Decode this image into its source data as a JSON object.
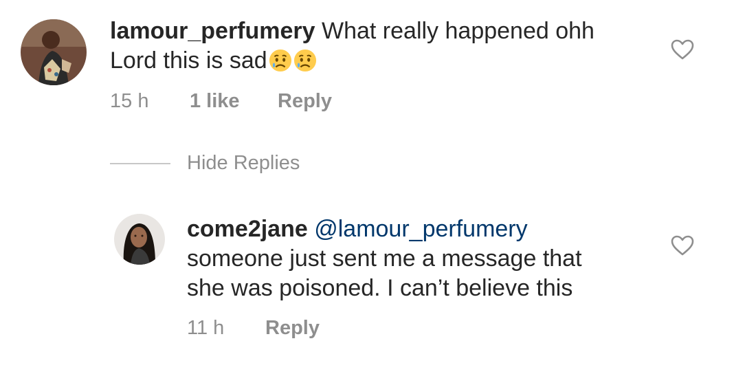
{
  "comments": [
    {
      "username": "lamour_perfumery",
      "text_line1": "What really happened ohh",
      "text_line2": "Lord this is sad",
      "emoji_icons": [
        "sad-relieved-face-icon",
        "sad-relieved-face-icon"
      ],
      "time": "15 h",
      "likes": "1 like",
      "reply_label": "Reply"
    }
  ],
  "replies_toggle": {
    "label": "Hide Replies"
  },
  "replies": [
    {
      "username": "come2jane",
      "mention": "@lamour_perfumery",
      "text_line1": "someone just sent me a message that",
      "text_line2": "she was poisoned. I can’t believe this",
      "time": "11 h",
      "reply_label": "Reply"
    }
  ],
  "colors": {
    "text": "#262626",
    "secondary": "#8e8e8e",
    "mention": "#00376b",
    "divider": "#c7c7c7"
  }
}
